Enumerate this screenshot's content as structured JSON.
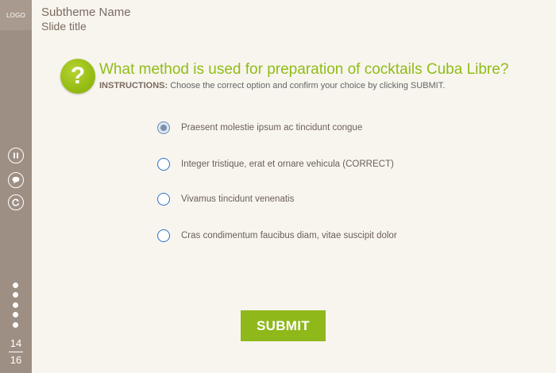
{
  "sidebar": {
    "logo": "LOGO",
    "controls": [
      {
        "name": "pause",
        "icon": "pause-icon"
      },
      {
        "name": "comment",
        "icon": "speech-bubble-icon"
      },
      {
        "name": "replay",
        "icon": "replay-icon"
      }
    ],
    "page": {
      "current": "14",
      "total": "16"
    }
  },
  "header": {
    "subtheme": "Subtheme Name",
    "slide_title": "Slide title"
  },
  "question": {
    "icon": "question-mark-icon",
    "icon_glyph": "?",
    "text": "What method is used for preparation of cocktails Cuba Libre?",
    "instructions_label": "INSTRUCTIONS:",
    "instructions_text": " Choose the correct option and confirm your choice by clicking SUBMIT."
  },
  "options": [
    {
      "label": "Praesent molestie ipsum ac tincidunt congue",
      "selected": true
    },
    {
      "label": "Integer tristique, erat et ornare vehicula (CORRECT)",
      "selected": false
    },
    {
      "label": "Vivamus tincidunt venenatis",
      "selected": false
    },
    {
      "label": "Cras condimentum faucibus diam, vitae suscipit dolor",
      "selected": false
    }
  ],
  "submit_label": "SUBMIT",
  "colors": {
    "sidebar": "#9e8f84",
    "accent_green": "#8fbd17",
    "background": "#f8f5ef",
    "radio_border": "#2f72c4"
  }
}
